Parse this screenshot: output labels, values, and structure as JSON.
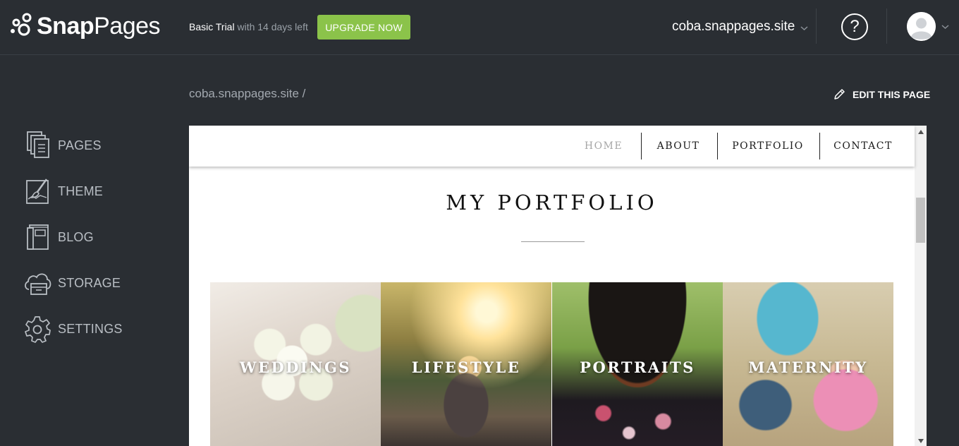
{
  "app": {
    "logo_text_bold": "Snap",
    "logo_text_light": "Pages",
    "trial_plan": "Basic Trial",
    "trial_days": " with 14 days left",
    "upgrade_label": "UPGRADE NOW",
    "site_selector": "coba.snappages.site",
    "help_symbol": "?"
  },
  "sidebar": {
    "items": [
      {
        "label": "PAGES",
        "icon": "pages-icon"
      },
      {
        "label": "THEME",
        "icon": "theme-brush-icon"
      },
      {
        "label": "BLOG",
        "icon": "blog-book-icon"
      },
      {
        "label": "STORAGE",
        "icon": "storage-cloud-icon"
      },
      {
        "label": "SETTINGS",
        "icon": "gear-icon"
      }
    ]
  },
  "content": {
    "breadcrumb": "coba.snappages.site /",
    "edit_label": "EDIT THIS PAGE"
  },
  "preview": {
    "nav": [
      {
        "label": "HOME",
        "active": true
      },
      {
        "label": "ABOUT",
        "active": false
      },
      {
        "label": "PORTFOLIO",
        "active": false
      },
      {
        "label": "CONTACT",
        "active": false
      }
    ],
    "title": "MY PORTFOLIO",
    "tiles": [
      {
        "label": "WEDDINGS"
      },
      {
        "label": "LIFESTYLE"
      },
      {
        "label": "PORTRAITS"
      },
      {
        "label": "MATERNITY"
      }
    ]
  },
  "colors": {
    "background": "#2a2e33",
    "accent_green": "#8bc34a",
    "sidebar_text": "#b9bec4",
    "nav_active": "#a6a6a6"
  }
}
